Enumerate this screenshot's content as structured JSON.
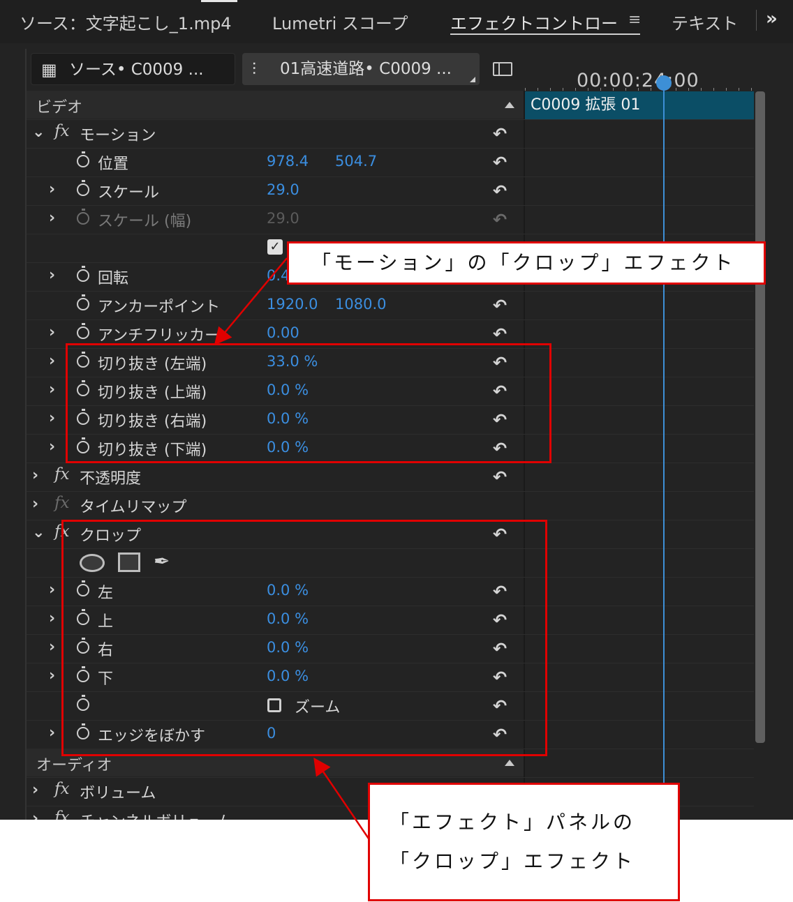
{
  "tabs": [
    {
      "label": "ソース：文字起こし_1.mp4",
      "active": false
    },
    {
      "label": "Lumetri スコープ",
      "active": false
    },
    {
      "label": "エフェクトコントロー",
      "active": true
    },
    {
      "label": "テキスト",
      "active": false
    }
  ],
  "more_icon": "»",
  "menu_icon": "≡",
  "header": {
    "source_clip": "ソース• C0009 ...",
    "sequence_clip": "01高速道路• C0009 ..."
  },
  "timeline": {
    "timecode": "00:00:24:00",
    "clip_name": "C0009 拡張 01"
  },
  "sections": {
    "video": "ビデオ",
    "audio": "オーディオ"
  },
  "effects": {
    "motion": {
      "name": "モーション",
      "position": {
        "label": "位置",
        "x": "978.4",
        "y": "504.7"
      },
      "scale": {
        "label": "スケール",
        "value": "29.0"
      },
      "scale_width": {
        "label": "スケール (幅)",
        "value": "29.0"
      },
      "uniform_scale_checked": true,
      "rotation": {
        "label": "回転",
        "value": "0.4"
      },
      "anchor": {
        "label": "アンカーポイント",
        "x": "1920.0",
        "y": "1080.0"
      },
      "antiflicker": {
        "label": "アンチフリッカー",
        "value": "0.00"
      },
      "crop_left": {
        "label": "切り抜き (左端)",
        "value": "33.0 %"
      },
      "crop_top": {
        "label": "切り抜き (上端)",
        "value": "0.0 %"
      },
      "crop_right": {
        "label": "切り抜き (右端)",
        "value": "0.0 %"
      },
      "crop_bottom": {
        "label": "切り抜き (下端)",
        "value": "0.0 %"
      }
    },
    "opacity": {
      "name": "不透明度"
    },
    "time_remap": {
      "name": "タイムリマップ"
    },
    "crop": {
      "name": "クロップ",
      "left": {
        "label": "左",
        "value": "0.0 %"
      },
      "top": {
        "label": "上",
        "value": "0.0 %"
      },
      "right": {
        "label": "右",
        "value": "0.0 %"
      },
      "bottom": {
        "label": "下",
        "value": "0.0 %"
      },
      "zoom": {
        "label": "ズーム",
        "checked": false
      },
      "feather": {
        "label": "エッジをぼかす",
        "value": "0"
      }
    },
    "volume": {
      "name": "ボリューム"
    },
    "channel_volume": {
      "name": "チャンネルボリューム"
    }
  },
  "annotations": {
    "callout_motion_crop": "「モーション」の「クロップ」エフェクト",
    "callout_effects_crop_line1": "「エフェクト」パネルの",
    "callout_effects_crop_line2": "「クロップ」エフェクト"
  },
  "colors": {
    "panel_bg": "#232323",
    "value_blue": "#3b8ee0",
    "clip_teal": "#0b4e66",
    "playhead": "#3d8fd6",
    "annotation_red": "#e00000"
  }
}
